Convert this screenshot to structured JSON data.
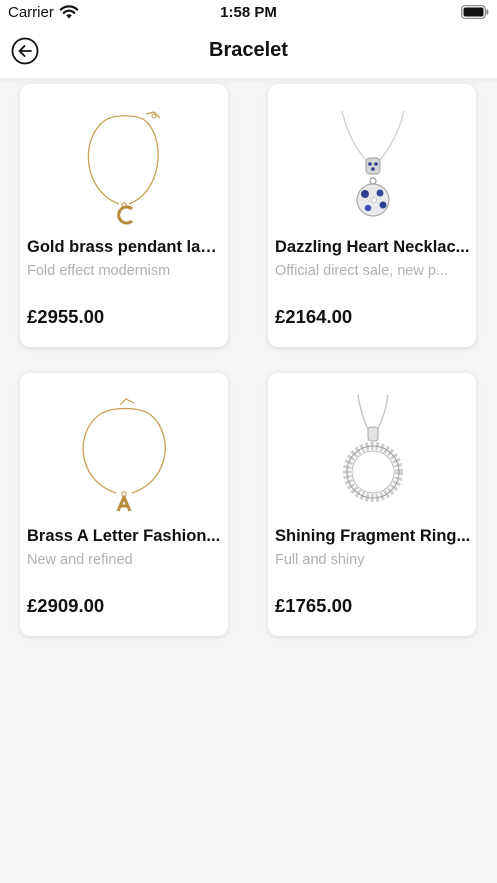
{
  "status_bar": {
    "carrier": "Carrier",
    "time": "1:58 PM"
  },
  "nav": {
    "title": "Bracelet",
    "back_icon": "back-arrow-circle-icon"
  },
  "products": [
    {
      "name": "Gold brass pendant lad...",
      "description": "Fold effect modernism",
      "price": "£2955.00",
      "image": "gold-pendant-c-necklace"
    },
    {
      "name": "Dazzling Heart Necklac...",
      "description": "Official direct sale, new p...",
      "price": "£2164.00",
      "image": "silver-blue-heart-pendant"
    },
    {
      "name": "Brass A Letter Fashion...",
      "description": "New and refined",
      "price": "£2909.00",
      "image": "gold-letter-a-necklace"
    },
    {
      "name": "Shining Fragment Ring...",
      "description": "Full and shiny",
      "price": "£1765.00",
      "image": "silver-ring-pendant"
    }
  ],
  "colors": {
    "background": "#f6f6f6",
    "card": "#ffffff",
    "muted_text": "#b0b0b0",
    "gold": "#c9a055",
    "silver": "#c4c4c4",
    "blue": "#2d3f8f"
  }
}
